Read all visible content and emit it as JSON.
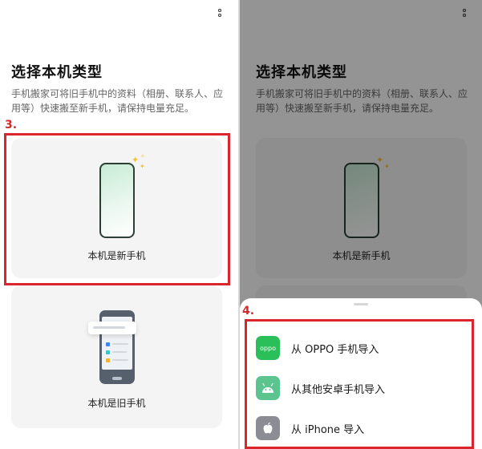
{
  "left_screen": {
    "title": "选择本机类型",
    "description": "手机搬家可将旧手机中的资料（相册、联系人、应用等）快速搬至新手机，请保持电量充足。",
    "cards": [
      {
        "label": "本机是新手机"
      },
      {
        "label": "本机是旧手机"
      }
    ]
  },
  "right_screen": {
    "title": "选择本机类型",
    "description": "手机搬家可将旧手机中的资料（相册、联系人、应用等）快速搬至新手机，请保持电量充足。",
    "card_label": "本机是新手机",
    "bottom_sheet": {
      "options": [
        {
          "label": "从 OPPO 手机导入",
          "icon": "oppo-icon",
          "icon_text": "oppo",
          "icon_color": "#2bbf5a"
        },
        {
          "label": "从其他安卓手机导入",
          "icon": "android-icon",
          "icon_color": "#5cc48e"
        },
        {
          "label": "从 iPhone 导入",
          "icon": "apple-icon",
          "icon_color": "#8c8c94"
        }
      ]
    }
  },
  "annotations": {
    "step3": "3.",
    "step4": "4."
  },
  "colors": {
    "annotation_red": "#d9262c",
    "sparkle_yellow": "#f3c12c"
  }
}
